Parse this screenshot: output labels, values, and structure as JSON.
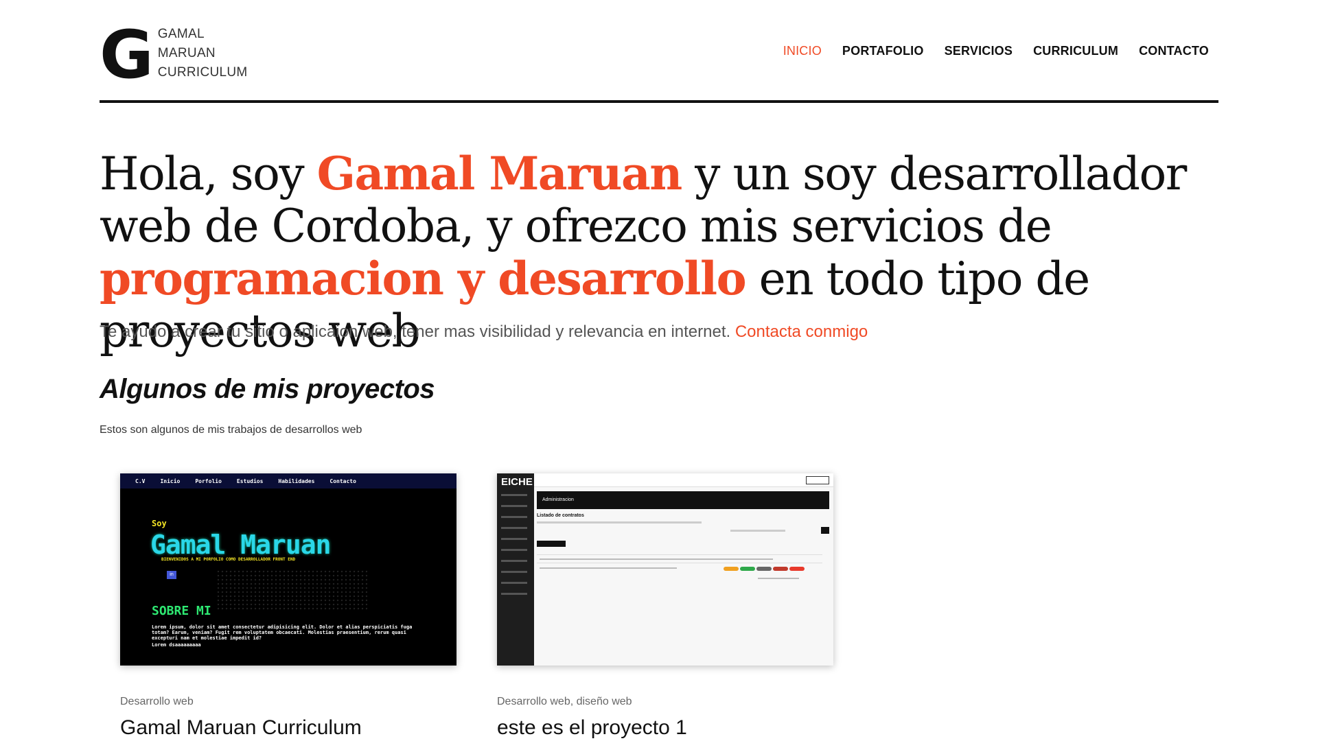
{
  "header": {
    "logo_letter": "G",
    "logo_lines": [
      "GAMAL",
      "MARUAN",
      "CURRICULUM"
    ],
    "nav": [
      "INICIO",
      "PORTAFOLIO",
      "SERVICIOS",
      "CURRICULUM",
      "CONTACTO"
    ],
    "active_nav": "INICIO"
  },
  "hero": {
    "part1": "Hola, soy ",
    "accent1": "Gamal Maruan",
    "part2": " y un soy desarrollador web de Cordoba, y ofrezco mis servicios de ",
    "accent2": "programacion y desarrollo",
    "part3": " en todo tipo de proyectos web"
  },
  "subtitle": {
    "text": "Te ayudo a crear tu sitio o aplicaion web, tener mas visibilidad y relevancia en internet. ",
    "link": "Contacta conmigo"
  },
  "projects": {
    "title": "Algunos de mis proyectos",
    "description": "Estos son algunos de mis trabajos de desarrollos web",
    "items": [
      {
        "category": "Desarrollo web",
        "title": "Gamal Maruan Curriculum",
        "thumb": {
          "nav": [
            "C.V",
            "Inicio",
            "Porfolio",
            "Estudios",
            "Habilidades",
            "Contacto"
          ],
          "soy": "Soy",
          "name": "Gamal Maruan",
          "tagline": "BIENVENIDOS A MI PORFOLIO COMO DESARROLLADOR FRONT END",
          "linkedin": "in",
          "section": "SOBRE MI",
          "lorem": "Lorem ipsum, dolor sit amet consectetur adipisicing elit. Dolor et alias perspiciatis fuga totam? Earum, veniam? Fugit rem voluptatem obcaecati. Molestias praesentium, rerum quasi excepturi nam et molestiae impedit id?",
          "lorem2": "Lorem dsaaaaaaaaa"
        }
      },
      {
        "category": "Desarrollo web, diseño web",
        "title": "este es el proyecto 1",
        "thumb": {
          "brand": "EICHE",
          "admin": "Administracion",
          "listado": "Listado de contratos"
        }
      }
    ]
  },
  "colors": {
    "accent": "#f04a25",
    "text": "#111111",
    "muted": "#555555"
  }
}
